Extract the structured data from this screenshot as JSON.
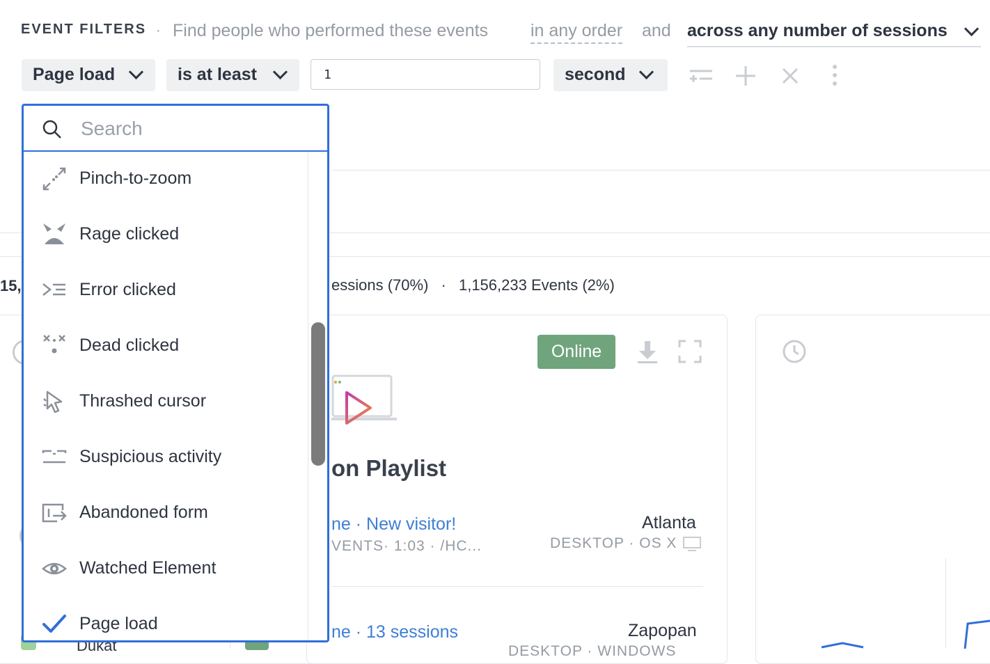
{
  "filters": {
    "title": "EVENT FILTERS",
    "separator": "·",
    "description": "Find people who performed these events",
    "order_label": "in any order",
    "and_label": "and",
    "sessions_label": "across any number of sessions",
    "event_select": "Page load",
    "operator_select": "is at least",
    "count_value": "1",
    "unit_select": "second"
  },
  "actions": {
    "icons": [
      "split-plus-icon",
      "plus-icon",
      "close-icon",
      "kebab-menu-icon"
    ]
  },
  "dropdown": {
    "search_placeholder": "Search",
    "items": [
      {
        "label": "Pinch-to-zoom",
        "icon": "pinch-zoom-icon",
        "selected": false
      },
      {
        "label": "Rage clicked",
        "icon": "rage-face-icon",
        "selected": false
      },
      {
        "label": "Error clicked",
        "icon": "error-click-icon",
        "selected": false
      },
      {
        "label": "Dead clicked",
        "icon": "dead-click-icon",
        "selected": false
      },
      {
        "label": "Thrashed cursor",
        "icon": "thrashed-cursor-icon",
        "selected": false
      },
      {
        "label": "Suspicious activity",
        "icon": "suspicious-activity-icon",
        "selected": false
      },
      {
        "label": "Abandoned form",
        "icon": "abandoned-form-icon",
        "selected": false
      },
      {
        "label": "Watched Element",
        "icon": "eye-icon",
        "selected": false
      },
      {
        "label": "Page load",
        "icon": "check-icon",
        "selected": true
      }
    ]
  },
  "stats": {
    "left_fragment": "15,",
    "sessions": "essions (70%)",
    "separator": "·",
    "events": "1,156,233 Events (2%)"
  },
  "card": {
    "status_badge": "Online",
    "playlist_title": "on Playlist",
    "row1": {
      "link": "ne · New visitor!",
      "meta": "VENTS· 1:03 · /HC...",
      "city": "Atlanta",
      "device": "DESKTOP · OS X"
    },
    "row2": {
      "link": "ne · 13 sessions",
      "city": "Zapopan",
      "device": "DESKTOP · WINDOWS"
    },
    "left_fragment": "Dukat"
  },
  "colors": {
    "accent_blue": "#2f6fd9",
    "online_green": "#6fa47c",
    "link_blue": "#3d7fd6"
  }
}
